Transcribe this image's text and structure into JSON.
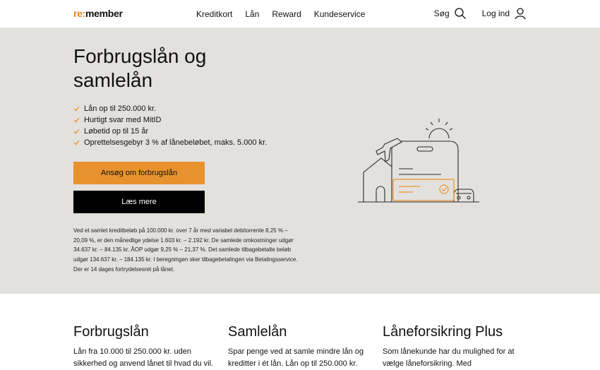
{
  "header": {
    "logo_prefix": "re:",
    "logo_suffix": "member",
    "nav": [
      "Kreditkort",
      "Lån",
      "Reward",
      "Kundeservice"
    ],
    "search_label": "Søg",
    "login_label": "Log ind"
  },
  "hero": {
    "title": "Forbrugslån og samlelån",
    "bullets": [
      "Lån op til 250.000 kr.",
      "Hurtigt svar med MitID",
      "Løbetid op til 15 år",
      "Oprettelsesgebyr 3 % af lånebeløbet, maks. 5.000 kr."
    ],
    "primary_button": "Ansøg om forbrugslån",
    "secondary_button": "Læs mere",
    "disclaimer": "Ved et samlet kreditbeløb på 100.000 kr. over 7 år med variabel debitorrente 8,25 % – 20,09 %, er den månedlige ydelse 1.603 kr. – 2.192 kr. De samlede omkostninger udgør 34.637 kr. – 84.135 kr. ÅOP udgør 9,25 % – 21,37 %. Det samlede tilbagebetalte beløb udgør 134.637 kr. – 184.135 kr. I beregningen sker tilbagebetalingen via Betalingsservice. Der er 14 dages fortrydelsesret på lånet."
  },
  "cards": [
    {
      "title": "Forbrugslån",
      "text": "Lån fra 10.000 til 250.000 kr. uden sikkerhed og anvend lånet til hvad du vil."
    },
    {
      "title": "Samlelån",
      "text": "Spar penge ved at samle mindre lån og kreditter i ét lån. Lån op til 250.000 kr."
    },
    {
      "title": "Låneforsikring Plus",
      "text": "Som lånekunde har du mulighed for at vælge låneforsikring. Med"
    }
  ],
  "colors": {
    "accent": "#e8922f",
    "hero_bg": "#e3e1dd",
    "dark_button": "#000000"
  },
  "icons": {
    "search": "search-icon",
    "user": "user-icon",
    "check": "check-icon"
  }
}
